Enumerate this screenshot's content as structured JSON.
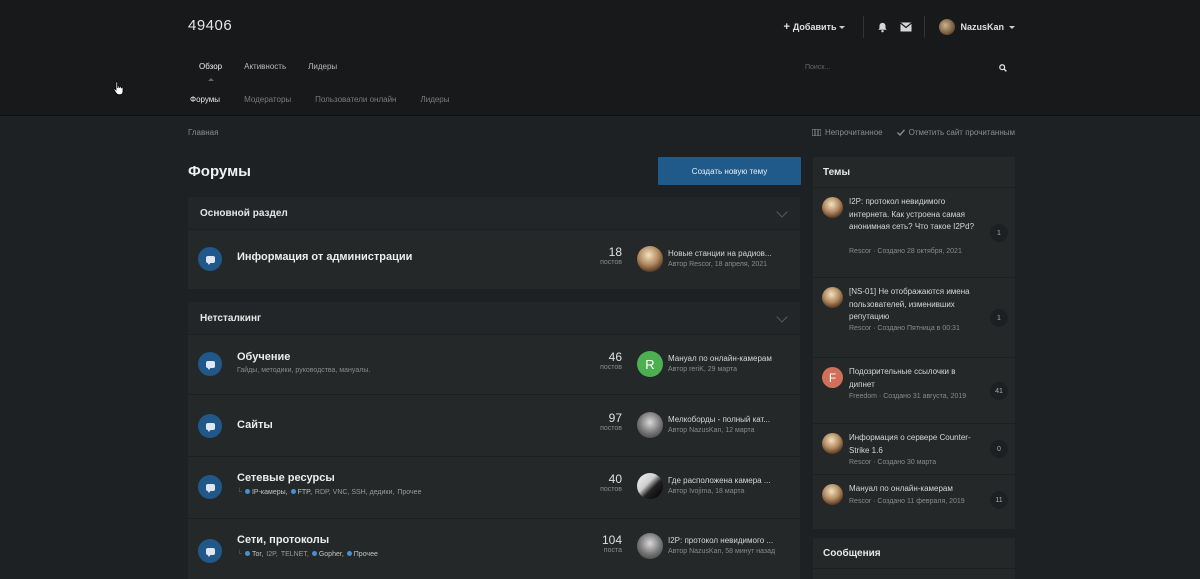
{
  "site": {
    "title": "49406"
  },
  "userbar": {
    "add_label": "Добавить",
    "username": "NazusKan"
  },
  "nav": {
    "main": [
      {
        "label": "Обзор",
        "active": true
      },
      {
        "label": "Активность",
        "active": false
      },
      {
        "label": "Лидеры",
        "active": false
      }
    ],
    "sub": [
      {
        "label": "Форумы",
        "active": true
      },
      {
        "label": "Модераторы",
        "active": false
      },
      {
        "label": "Пользователи онлайн",
        "active": false
      },
      {
        "label": "Лидеры",
        "active": false
      }
    ]
  },
  "search": {
    "placeholder": "Поиск..."
  },
  "breadcrumb": {
    "home": "Главная"
  },
  "crumb_actions": {
    "unread": "Непрочитанное",
    "mark_read": "Отметить сайт прочитанным"
  },
  "page": {
    "title": "Форумы",
    "new_topic": "Создать новую тему"
  },
  "sections": [
    {
      "title": "Основной раздел",
      "forums": [
        {
          "name": "Информация от администрации",
          "posts": "18",
          "posts_label": "постов",
          "last_title": "Новые станции на радиов...",
          "last_meta": "Автор Rescor, 18 апреля, 2021",
          "avatar": "rescor"
        }
      ]
    },
    {
      "title": "Нетсталкинг",
      "forums": [
        {
          "name": "Обучение",
          "desc": "Гайды, методики, руководства, мануалы.",
          "posts": "46",
          "posts_label": "постов",
          "last_title": "Мануал по онлайн-камерам",
          "last_meta": "Автор reriK, 29 марта",
          "avatar": "R"
        },
        {
          "name": "Сайты",
          "posts": "97",
          "posts_label": "постов",
          "last_title": "Мелкоборды - полный кат...",
          "last_meta": "Автор NazusKan, 12 марта",
          "avatar": "nazus"
        },
        {
          "name": "Сетевые ресурсы",
          "subforums": [
            {
              "label": "IP-камеры",
              "unread": true
            },
            {
              "label": "FTP",
              "unread": true
            },
            {
              "label": "RDP, VNC, SSH, дедики",
              "unread": false
            },
            {
              "label": "Прочее",
              "unread": false
            }
          ],
          "posts": "40",
          "posts_label": "постов",
          "last_title": "Где расположена камера ...",
          "last_meta": "Автор Ivojima, 18 марта",
          "avatar": "ivojima"
        },
        {
          "name": "Сети, протоколы",
          "subforums": [
            {
              "label": "Tor",
              "unread": true
            },
            {
              "label": "I2P",
              "unread": false
            },
            {
              "label": "TELNET",
              "unread": false
            },
            {
              "label": "Gopher",
              "unread": true
            },
            {
              "label": "Прочее",
              "unread": true
            }
          ],
          "posts": "104",
          "posts_label": "поста",
          "last_title": "I2P: протокол невидимого ...",
          "last_meta": "Автор NazusKan, 58 минут назад",
          "avatar": "nazus"
        }
      ]
    }
  ],
  "sidebar": {
    "topics_title": "Темы",
    "topics": [
      {
        "title": "I2P: протокол невидимого интернета. Как устроена самая анонимная сеть? Что такое I2Pd?",
        "meta": "Rescor · Создано 28 октября, 2021",
        "count": "1",
        "avatar": "rescor"
      },
      {
        "title": "[NS-01] Не отображаются имена пользователей, изменивших репутацию",
        "meta": "Rescor · Создано Пятница в 00:31",
        "count": "1",
        "avatar": "rescor"
      },
      {
        "title": "Подозрительные ссылочки в дипнет",
        "meta": "Freedom · Создано 31 августа, 2019",
        "count": "41",
        "avatar": "F"
      },
      {
        "title": "Информация о сервере Counter-Strike 1.6",
        "meta": "Rescor · Создано 30 марта",
        "count": "0",
        "avatar": "rescor"
      },
      {
        "title": "Мануал по онлайн-камерам",
        "meta": "Rescor · Создано 11 февраля, 2019",
        "count": "11",
        "avatar": "rescor"
      }
    ],
    "messages_title": "Сообщения"
  }
}
